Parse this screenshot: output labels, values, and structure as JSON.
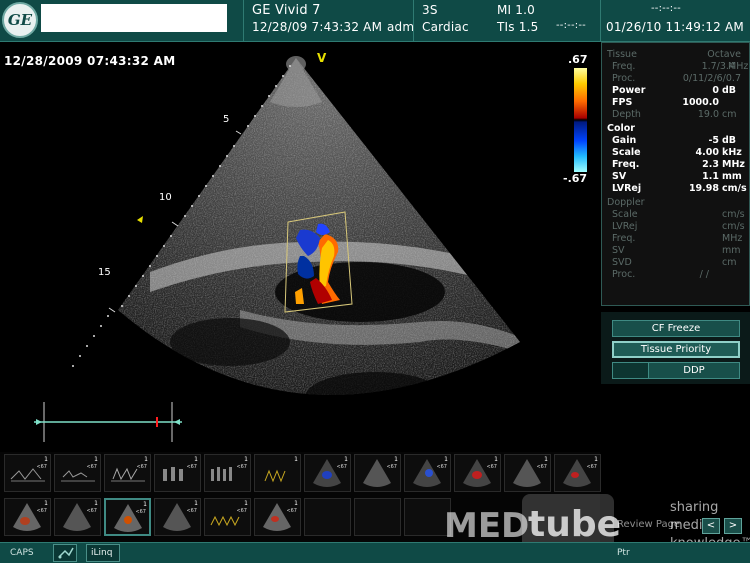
{
  "header": {
    "logo_text": "GE",
    "system": "GE Vivid 7",
    "exam_datetime": "12/28/09 7:43:32 AM",
    "operator": "adm",
    "probe": "3S",
    "application": "Cardiac",
    "mi": "MI 1.0",
    "tis": "TIs 1.5",
    "placeholder_1": "--:--:--",
    "placeholder_2": "--:--:--",
    "current_datetime": "01/26/10 11:49:12 AM"
  },
  "image": {
    "timestamp": "12/28/2009 07:43:32 AM",
    "orientation_marker": "V",
    "depth_marks": [
      "5",
      "10",
      "15"
    ],
    "color_scale_max": ".67",
    "color_scale_min": "-.67"
  },
  "params": {
    "tissue_header": "Tissue",
    "tissue_mode": "Octave",
    "tissue": [
      {
        "label": "Freq.",
        "value": "1.7/3.4",
        "unit": "MHz",
        "dim": true
      },
      {
        "label": "Proc.",
        "value": "0/11/2/6/0.7",
        "unit": "",
        "dim": true
      },
      {
        "label": "Power",
        "value": "0",
        "unit": "dB",
        "dim": false
      },
      {
        "label": "FPS",
        "value": "1000.0",
        "unit": "",
        "dim": false
      },
      {
        "label": "Depth",
        "value": "19.0",
        "unit": "cm",
        "dim": true
      }
    ],
    "color_header": "Color",
    "color": [
      {
        "label": "Gain",
        "value": "-5",
        "unit": "dB"
      },
      {
        "label": "Scale",
        "value": "4.00",
        "unit": "kHz"
      },
      {
        "label": "Freq.",
        "value": "2.3",
        "unit": "MHz"
      },
      {
        "label": "SV",
        "value": "1.1",
        "unit": "mm"
      },
      {
        "label": "LVRej",
        "value": "19.98",
        "unit": "cm/s"
      }
    ],
    "doppler_header": "Doppler",
    "doppler": [
      {
        "label": "Scale",
        "value": "",
        "unit": "cm/s"
      },
      {
        "label": "LVRej",
        "value": "",
        "unit": "cm/s"
      },
      {
        "label": "Freq.",
        "value": "",
        "unit": "MHz"
      },
      {
        "label": "SV",
        "value": "",
        "unit": "mm"
      },
      {
        "label": "SVD",
        "value": "",
        "unit": "cm"
      },
      {
        "label": "Proc.",
        "value": "/ /",
        "unit": ""
      }
    ]
  },
  "buttons": {
    "cf_freeze": "CF Freeze",
    "tissue_priority": "Tissue Priority",
    "ddp": "DDP"
  },
  "thumbnails": {
    "label": "<67",
    "index": "1"
  },
  "review": {
    "label": "Review Page",
    "prev": "<",
    "next": ">"
  },
  "watermark": {
    "brand_left": "MED",
    "brand_right": "tube",
    "tagline_1": "sharing",
    "tagline_2": "medical",
    "tagline_3": "knowledge™"
  },
  "footer": {
    "caps": "CAPS",
    "iling": "iLinq",
    "ptr": "Ptr"
  },
  "colors": {
    "header_bg": "#0f4a46",
    "accent": "#3f8a83"
  }
}
